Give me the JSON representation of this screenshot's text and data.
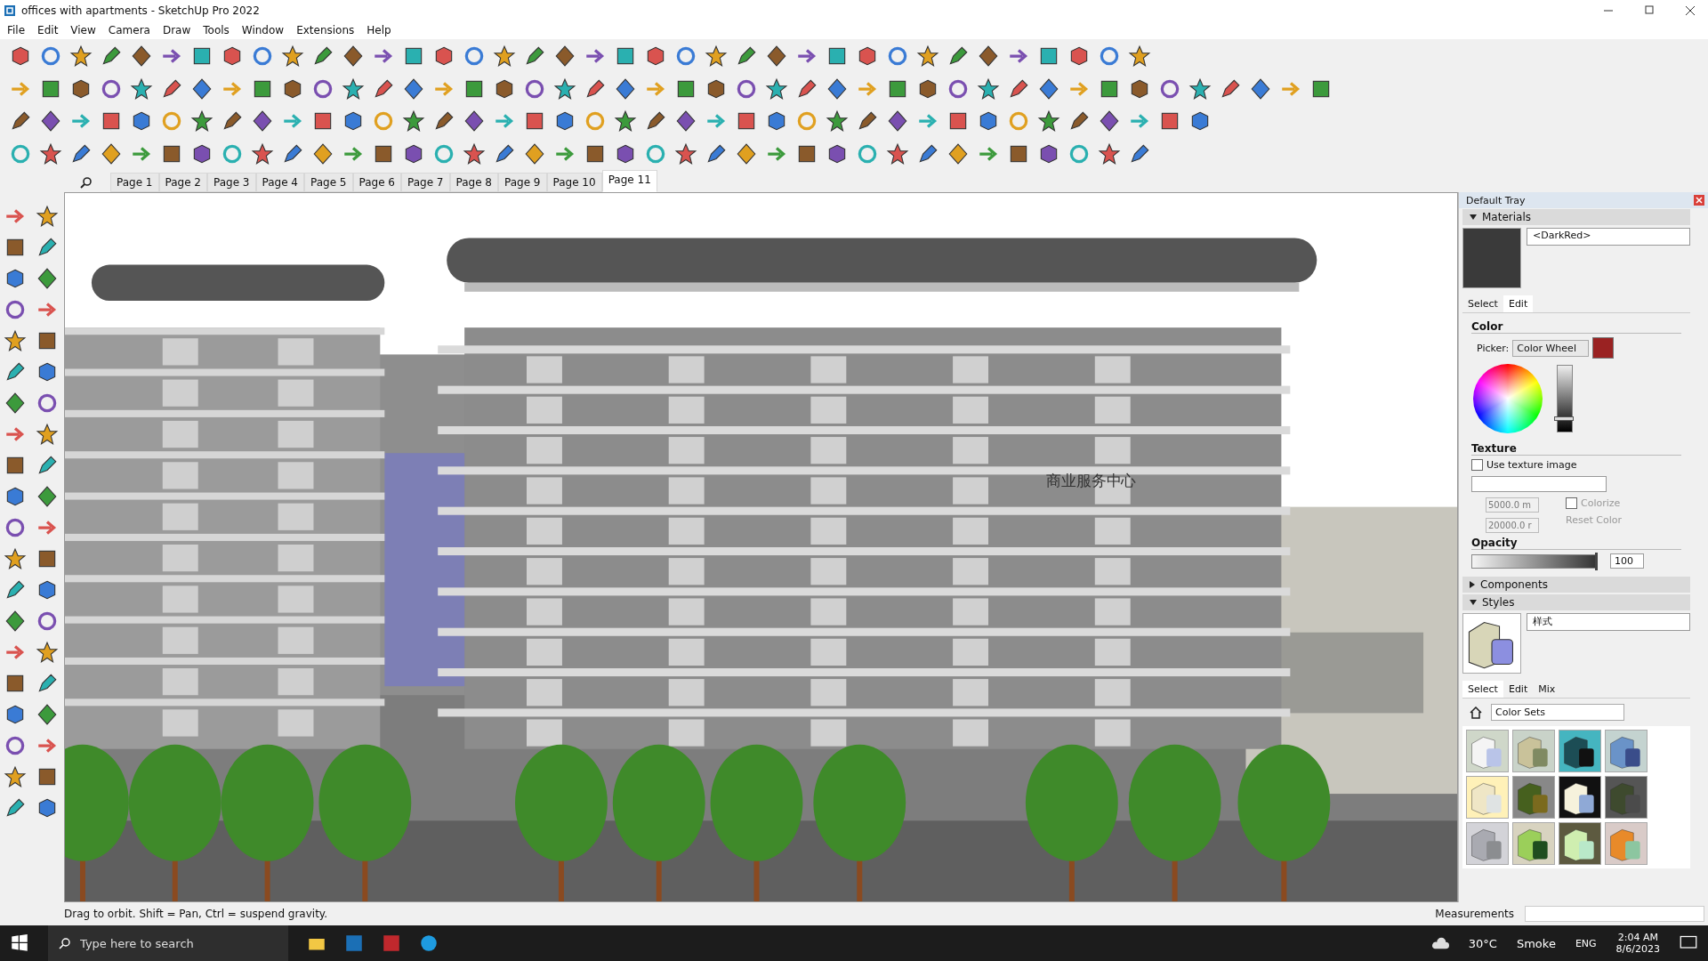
{
  "window": {
    "title": "offices with apartments - SketchUp Pro 2022"
  },
  "menu": [
    "File",
    "Edit",
    "View",
    "Camera",
    "Draw",
    "Tools",
    "Window",
    "Extensions",
    "Help"
  ],
  "scenes": [
    {
      "label": "Page 1",
      "selected": false
    },
    {
      "label": "Page 2",
      "selected": false
    },
    {
      "label": "Page 3",
      "selected": false
    },
    {
      "label": "Page 4",
      "selected": false
    },
    {
      "label": "Page 5",
      "selected": false
    },
    {
      "label": "Page 6",
      "selected": false
    },
    {
      "label": "Page 7",
      "selected": false
    },
    {
      "label": "Page 8",
      "selected": false
    },
    {
      "label": "Page 9",
      "selected": false
    },
    {
      "label": "Page 10",
      "selected": false
    },
    {
      "label": "Page 11",
      "selected": true
    }
  ],
  "viewport": {
    "sign": "商业服务中心"
  },
  "tray": {
    "title": "Default Tray",
    "materials": {
      "title": "Materials",
      "expanded": true,
      "name": "<DarkRed>",
      "tabs": [
        {
          "label": "Select",
          "selected": false
        },
        {
          "label": "Edit",
          "selected": true
        }
      ],
      "color_heading": "Color",
      "picker_label": "Picker:",
      "picker": "Color Wheel",
      "brightness": {
        "level": 0.2
      },
      "texture_heading": "Texture",
      "use_texture": {
        "label": "Use texture image",
        "checked": false
      },
      "width": "5000.0 m",
      "height": "20000.0 r",
      "colorize": {
        "label": "Colorize",
        "checked": false
      },
      "reset": "Reset Color",
      "opacity_heading": "Opacity",
      "opacity": {
        "level": 1,
        "reading": "100"
      }
    },
    "components": {
      "title": "Components",
      "expanded": false
    },
    "styles": {
      "title": "Styles",
      "expanded": true,
      "name": "样式",
      "tabs": [
        {
          "label": "Select",
          "selected": true
        },
        {
          "label": "Edit",
          "selected": false
        },
        {
          "label": "Mix",
          "selected": false
        }
      ],
      "collection": "Color Sets"
    }
  },
  "status": {
    "hint": "Drag to orbit. Shift = Pan, Ctrl = suspend gravity.",
    "measurements_label": "Measurements"
  },
  "taskbar": {
    "search_placeholder": "Type here to search",
    "temperature": "30°C",
    "weather": "Smoke",
    "language": "ENG",
    "time": "2:04 AM",
    "date": "8/6/2023"
  }
}
